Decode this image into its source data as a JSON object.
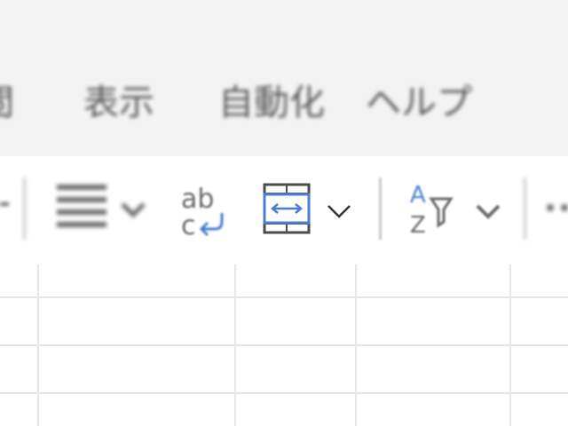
{
  "menu": {
    "partial_tab": "閲",
    "tabs": [
      {
        "label": "表示"
      },
      {
        "label": "自動化"
      },
      {
        "label": "ヘルプ"
      }
    ]
  },
  "toolbar": {
    "align_icon": "align-lines-icon",
    "wrap_text": {
      "icon": "wrap-text-icon",
      "glyph_top": "ab",
      "glyph_bottom": "c"
    },
    "merge_center": {
      "icon": "merge-center-icon"
    },
    "sort_filter": {
      "icon": "sort-filter-icon",
      "glyph_a": "A",
      "glyph_z": "Z"
    }
  },
  "colors": {
    "accent": "#4a7fd0",
    "icon_gray": "#6a6a6a",
    "menu_bg": "#f3f3f3"
  }
}
